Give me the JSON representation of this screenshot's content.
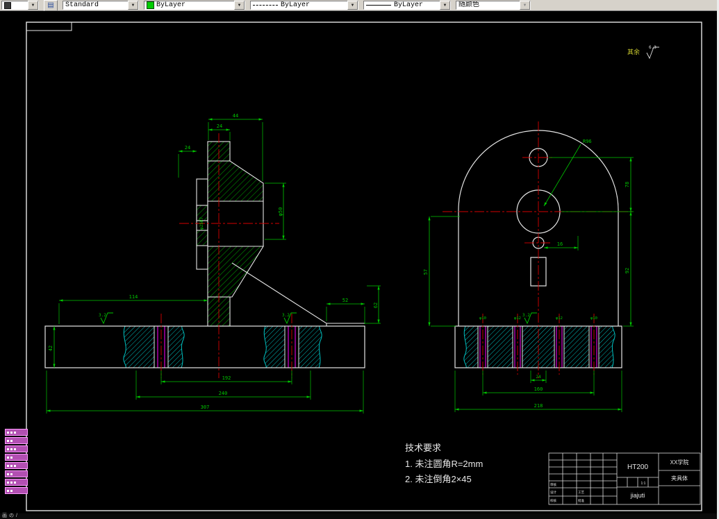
{
  "icons": {
    "dropdown": "▼",
    "layers": "▤"
  },
  "toolbar": {
    "style": "Standard",
    "color": "ByLayer",
    "linetype": "ByLayer",
    "lineweight": "ByLayer",
    "plotstyle": "随颜色"
  },
  "drawing": {
    "general_note": {
      "prefix": "其余",
      "value": "6.3"
    },
    "roughness": "3.2",
    "tech": {
      "title": "技术要求",
      "item1": "1.  未注圆角R=2mm",
      "item2": "2.  未注倒角2×45"
    },
    "left": {
      "d_top": "44",
      "d_boss": "24",
      "d_left": "24",
      "d_bore": "φ25H7",
      "d_hub": "φ50",
      "d_mid": "114",
      "d_step": "52",
      "d_step_v": "62",
      "d_c1": "192",
      "d_c2": "240",
      "d_c3": "307",
      "d_base_h": "42"
    },
    "right": {
      "r": "R96",
      "d_lv": "57",
      "d_rv1": "78",
      "d_rv2": "92",
      "d_hole": "16",
      "d_c1": "24",
      "d_c2": "160",
      "d_c3": "218",
      "h1": "φ10",
      "h2": "φ12",
      "h3": "φ12",
      "h4": "φ10"
    }
  },
  "title_block": {
    "material": "HT200",
    "org": "XX学院",
    "part": "夹具体",
    "code": "jiajuti",
    "scale": "1:1",
    "l1": "设计",
    "l2": "校核",
    "l3": "审核",
    "l4": "工艺",
    "l5": "批准"
  },
  "statusbar": {
    "i1": "画",
    "i2": "の",
    "i3": "/"
  }
}
